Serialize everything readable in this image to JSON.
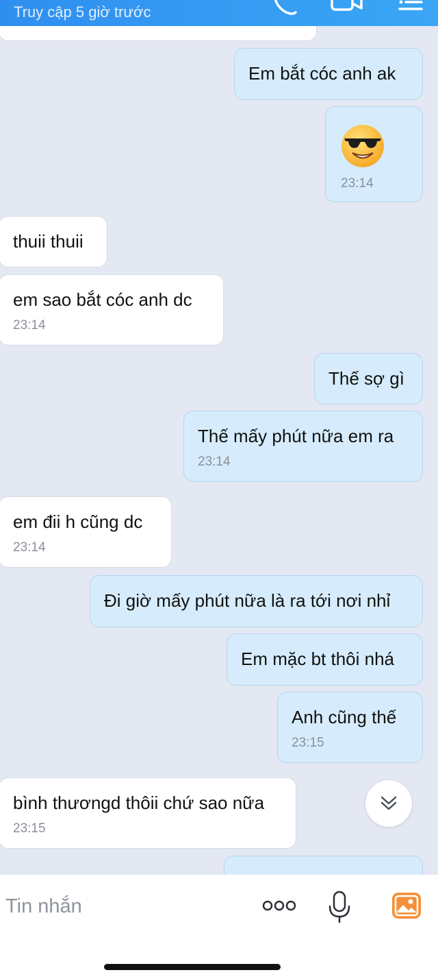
{
  "header": {
    "status": "Truy cập 5 giờ trước",
    "icons": [
      "phone-icon",
      "video-call-icon",
      "menu-icon"
    ]
  },
  "messages": [
    {
      "side": "in",
      "text": "",
      "time": ""
    },
    {
      "side": "out",
      "text": "Em bắt cóc anh ak",
      "time": ""
    },
    {
      "side": "out",
      "emoji": "sunglasses-emoji",
      "time": "23:14"
    },
    {
      "side": "in",
      "text": "thuii thuii",
      "time": ""
    },
    {
      "side": "in",
      "text": "em sao bắt cóc anh dc",
      "time": "23:14"
    },
    {
      "side": "out",
      "text": "Thế sợ gì",
      "time": ""
    },
    {
      "side": "out",
      "text": "Thế mấy phút nữa em ra",
      "time": "23:14"
    },
    {
      "side": "in",
      "text": "em đii h cũng dc",
      "time": "23:14"
    },
    {
      "side": "out",
      "text": "Đi giờ mấy phút nữa là ra tới nơi nhỉ",
      "time": ""
    },
    {
      "side": "out",
      "text": "Em mặc bt thôi nhá",
      "time": ""
    },
    {
      "side": "out",
      "text": "Anh cũng thế",
      "time": "23:15"
    },
    {
      "side": "in",
      "text": "bình thươngd thôii chứ sao nữa",
      "time": "23:15"
    },
    {
      "side": "out",
      "text": "",
      "time": ""
    }
  ],
  "composer": {
    "placeholder": "Tin nhắn",
    "icons": [
      "more-options-icon",
      "microphone-icon",
      "gallery-icon"
    ]
  },
  "colors": {
    "header_bg": "#3399f3",
    "chat_bg": "#e4e8f2",
    "incoming_bubble": "#ffffff",
    "outgoing_bubble": "#d6ecfc",
    "timestamp": "#8a8f99",
    "gallery_icon": "#f5903a"
  }
}
